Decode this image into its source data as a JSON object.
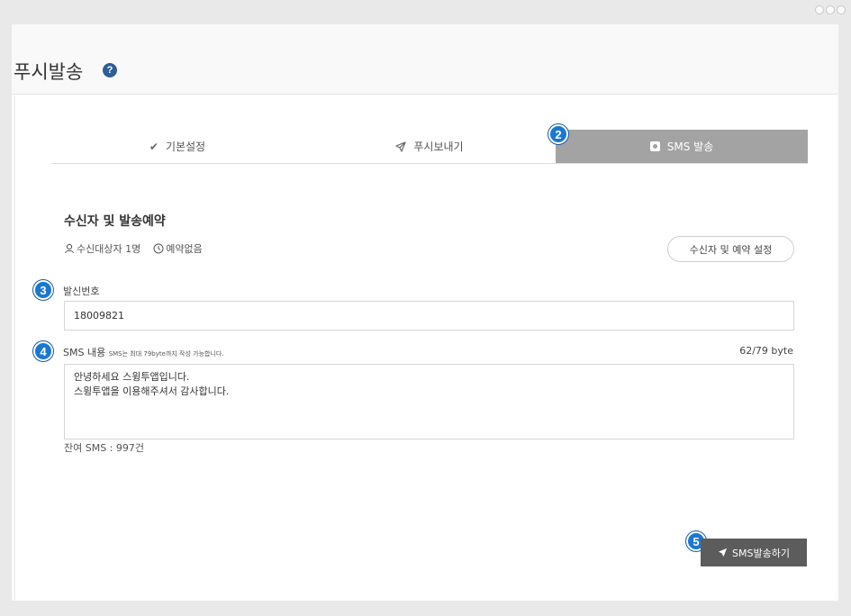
{
  "page": {
    "title": "푸시발송",
    "help_symbol": "?"
  },
  "tabs": [
    {
      "label": "기본설정",
      "icon": "check-icon",
      "active": false
    },
    {
      "label": "푸시보내기",
      "icon": "send-icon",
      "active": false
    },
    {
      "label": "SMS 발송",
      "icon": "sms-icon",
      "active": true
    }
  ],
  "badges": {
    "tab": "2",
    "sender": "3",
    "content": "4",
    "send": "5"
  },
  "recipients": {
    "title": "수신자 및 발송예약",
    "count_text": "수신대상자 1명",
    "schedule_text": "예약없음",
    "setup_button": "수신자 및 예약 설정"
  },
  "sender": {
    "label": "발신번호",
    "value": "18009821"
  },
  "sms": {
    "label": "SMS 내용",
    "hint": "SMS는 최대 79byte까지 작성 가능합니다.",
    "byte_count": "62/79 byte",
    "content": "안녕하세요 스윙투앱입니다.\n스윙투앱을 이용해주셔서 감사합니다.",
    "remaining": "잔여 SMS : 997건"
  },
  "send_button": "SMS발송하기",
  "colors": {
    "active_tab": "#a3a3a3",
    "send_button": "#5c5c5c",
    "badge": "#1a78d2",
    "help_icon": "#2f5f93"
  }
}
